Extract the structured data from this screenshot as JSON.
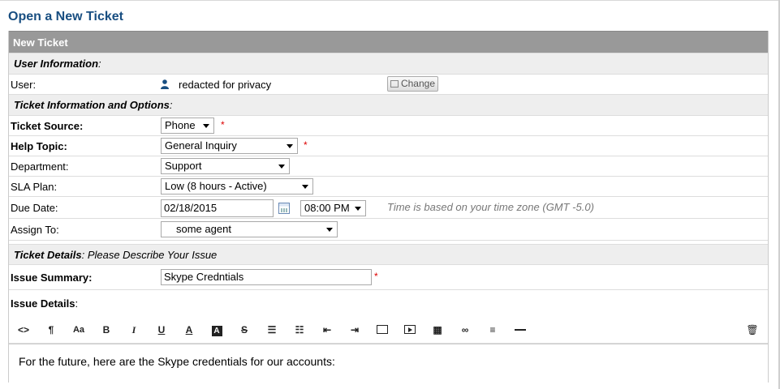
{
  "page": {
    "title": "Open a New Ticket"
  },
  "form": {
    "header": "New Ticket",
    "user_section": {
      "title": "User Information",
      "suffix": ":"
    },
    "user": {
      "label": "User:",
      "value": "redacted for privacy",
      "change_button": "Change"
    },
    "ticket_section": {
      "title": "Ticket Information and Options",
      "suffix": ":"
    },
    "ticket_source": {
      "label": "Ticket Source:",
      "value": "Phone",
      "required": "*"
    },
    "help_topic": {
      "label": "Help Topic:",
      "value": "General Inquiry",
      "required": "*"
    },
    "department": {
      "label": "Department:",
      "value": "Support"
    },
    "sla_plan": {
      "label": "SLA Plan:",
      "value": "Low (8 hours - Active)"
    },
    "due_date": {
      "label": "Due Date:",
      "date": "02/18/2015",
      "time": "08:00 PM",
      "hint": "Time is based on your time zone (GMT -5.0)"
    },
    "assign_to": {
      "label": "Assign To:",
      "value": "some agent"
    },
    "details_section": {
      "title": "Ticket Details",
      "rest": ": Please Describe Your Issue"
    },
    "issue_summary": {
      "label": "Issue Summary:",
      "value": "Skype Credntials",
      "required": "*"
    },
    "issue_details": {
      "label": "Issue Details",
      "suffix": ":"
    },
    "editor": {
      "text": "For the future, here are the Skype credentials for our accounts:",
      "toolbar": {
        "paragraph": "¶",
        "font_size": "Aa",
        "bold": "B",
        "italic": "I",
        "underline": "U",
        "font_color": "A",
        "bg_color": "A",
        "strike": "S"
      }
    }
  },
  "colors": {
    "title": "#184e81",
    "header_bg": "#999999",
    "section_bg": "#eeeeee",
    "required": "#dd0000"
  }
}
